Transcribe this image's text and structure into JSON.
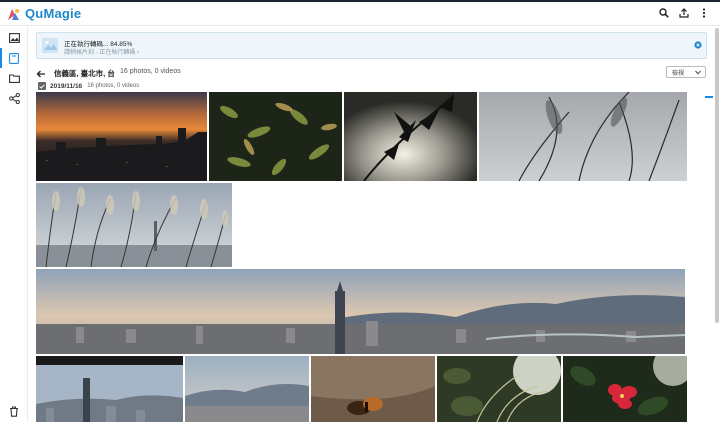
{
  "app": {
    "name": "QuMagie"
  },
  "header": {
    "icons": [
      "search-icon",
      "upload-icon",
      "more-vert-icon"
    ]
  },
  "sidebar": {
    "icons": [
      "photos-icon",
      "albums-icon",
      "folder-icon",
      "share-icon",
      "trash-icon"
    ],
    "active": "albums-icon"
  },
  "banner": {
    "title": "正在執行轉碼... 84.85%",
    "subtitle": "請稍候片刻 - 正在執行轉碼 ›"
  },
  "location": {
    "title": "信義區, 臺北市, 台",
    "count": "16 photos, 0 videos"
  },
  "sort": {
    "label": "檢視"
  },
  "group": {
    "date": "2019/11/16",
    "count": "16 photos, 0 videos"
  },
  "photos": [
    {
      "name": "sunset-city"
    },
    {
      "name": "foliage"
    },
    {
      "name": "leaves-silhouette"
    },
    {
      "name": "grass-sky"
    },
    {
      "name": "reeds-taipei101"
    },
    {
      "name": "taipei-panorama"
    },
    {
      "name": "taipei101-closeup"
    },
    {
      "name": "mountains-city"
    },
    {
      "name": "butterfly"
    },
    {
      "name": "grass-backlight"
    },
    {
      "name": "red-hibiscus"
    }
  ],
  "colors": {
    "accent": "#1e88e5",
    "logo": "#1e88c8",
    "banner_bg": "#eef6fb"
  }
}
